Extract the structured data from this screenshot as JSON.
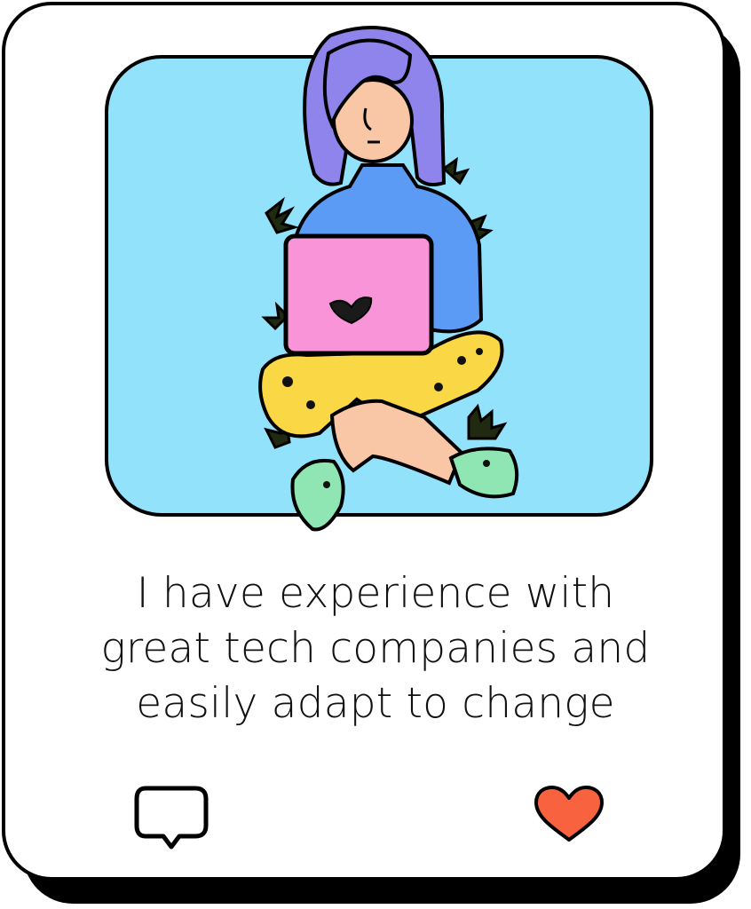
{
  "post": {
    "caption_lines": [
      "I have experience with",
      "great tech companies and",
      "easily adapt to change"
    ]
  },
  "actions": {
    "comment_icon": "speech-bubble-icon",
    "like_icon": "heart-icon",
    "like_color": "#f8623f"
  },
  "colors": {
    "sky": "#93e2fb",
    "hair": "#8e84ec",
    "sweater": "#5b9bf6",
    "laptop": "#f994d9",
    "pants": "#f9d745",
    "socks": "#8fe6b3",
    "skin": "#f9c6a6",
    "outline": "#000000"
  }
}
